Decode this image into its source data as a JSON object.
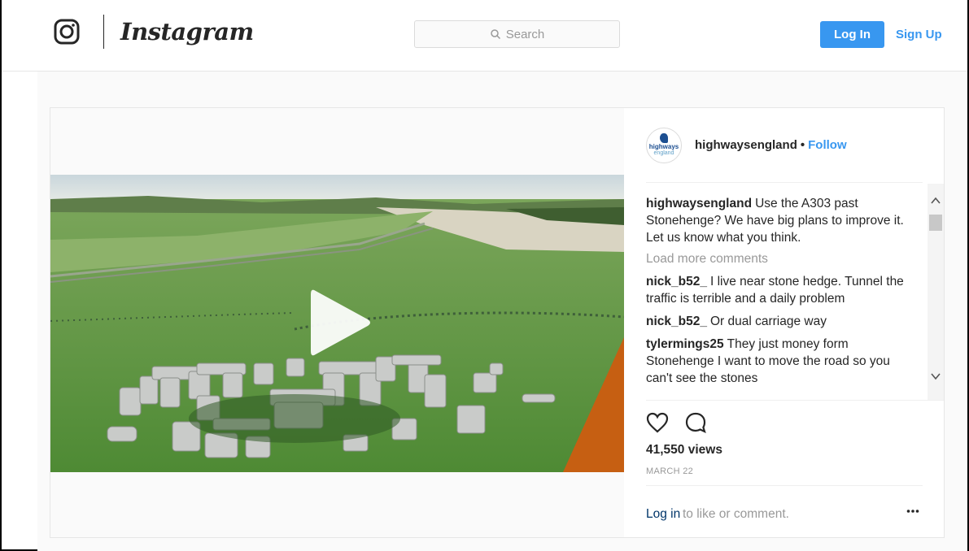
{
  "header": {
    "wordmark": "Instagram",
    "search_placeholder": "Search",
    "login_label": "Log In",
    "signup_label": "Sign Up",
    "icons": [
      "instagram-glyph-icon",
      "search-icon"
    ]
  },
  "post": {
    "username": "highwaysengland",
    "separator": "•",
    "follow_label": "Follow",
    "avatar_text_line1": "highways",
    "avatar_text_line2": "england",
    "caption": {
      "user": "highwaysengland",
      "text": "Use the A303 past Stonehenge? We have big plans to improve it. Let us know what you think."
    },
    "load_more": "Load more comments",
    "comments": [
      {
        "user": "nick_b52_",
        "text": "I live near stone hedge. Tunnel the traffic is terrible and a daily problem"
      },
      {
        "user": "nick_b52_",
        "text": "Or dual carriage way"
      },
      {
        "user": "tylermings25",
        "text": "They just money form Stonehenge I want to move the road so you can't see the stones"
      }
    ],
    "views": "41,550 views",
    "date": "MARCH 22",
    "footer_login": "Log in",
    "footer_text": "to like or comment.",
    "icons": [
      "play-icon",
      "heart-icon",
      "comment-icon",
      "more-options-icon",
      "chevron-up-icon",
      "chevron-down-icon"
    ]
  },
  "colors": {
    "accent": "#3897f0",
    "text": "#262626",
    "muted": "#999999",
    "border": "#e6e6e6",
    "background": "#fafafa"
  }
}
